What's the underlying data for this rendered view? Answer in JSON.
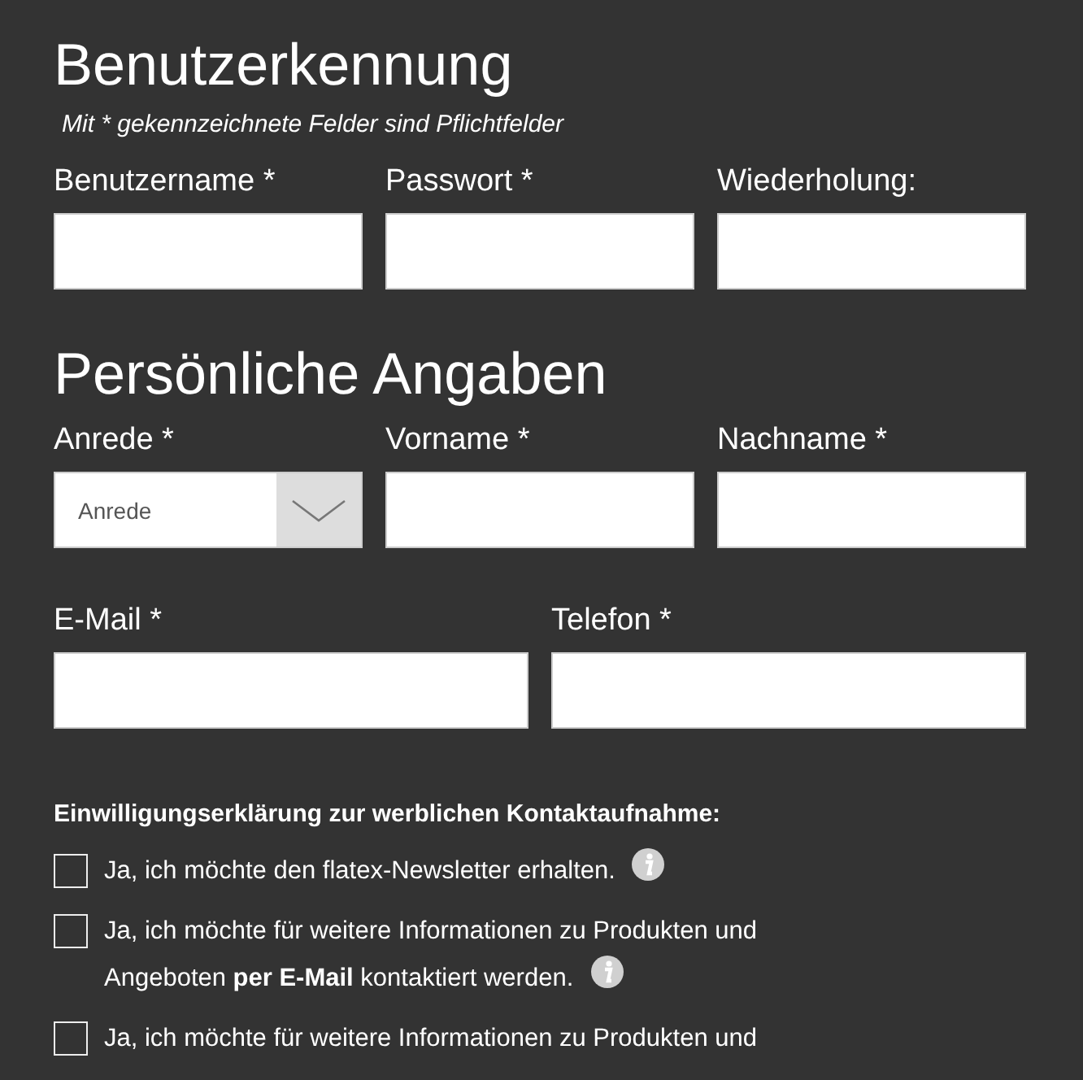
{
  "sections": [
    {
      "title": "Benutzerkennung",
      "note": "Mit * gekennzeichnete Felder sind Pflichtfelder",
      "rows": [
        [
          {
            "label": "Benutzername *",
            "kind": "text"
          },
          {
            "label": "Passwort *",
            "kind": "text"
          },
          {
            "label": "Wiederholung:",
            "kind": "text"
          }
        ]
      ]
    },
    {
      "title": "Persönliche Angaben",
      "rows": [
        [
          {
            "label": "Anrede *",
            "kind": "select",
            "value": "Anrede"
          },
          {
            "label": "Vorname *",
            "kind": "text"
          },
          {
            "label": "Nachname *",
            "kind": "text"
          }
        ],
        [
          {
            "label": "E-Mail *",
            "kind": "text"
          },
          {
            "label": "Telefon *",
            "kind": "text"
          }
        ]
      ]
    }
  ],
  "consent": {
    "title": "Einwilligungserklärung zur werblichen Kontaktaufnahme:",
    "items": [
      {
        "text": "Ja, ich möchte den flatex-Newsletter erhalten.",
        "checked": false,
        "info": true
      },
      {
        "text": "Ja, ich möchte für weitere Informationen zu Produkten und Angeboten **per E-Mail** kontaktiert werden.",
        "checked": false,
        "info": true
      },
      {
        "text": "Ja, ich möchte für weitere Informationen zu Produkten und",
        "checked": false,
        "info": false
      }
    ]
  }
}
